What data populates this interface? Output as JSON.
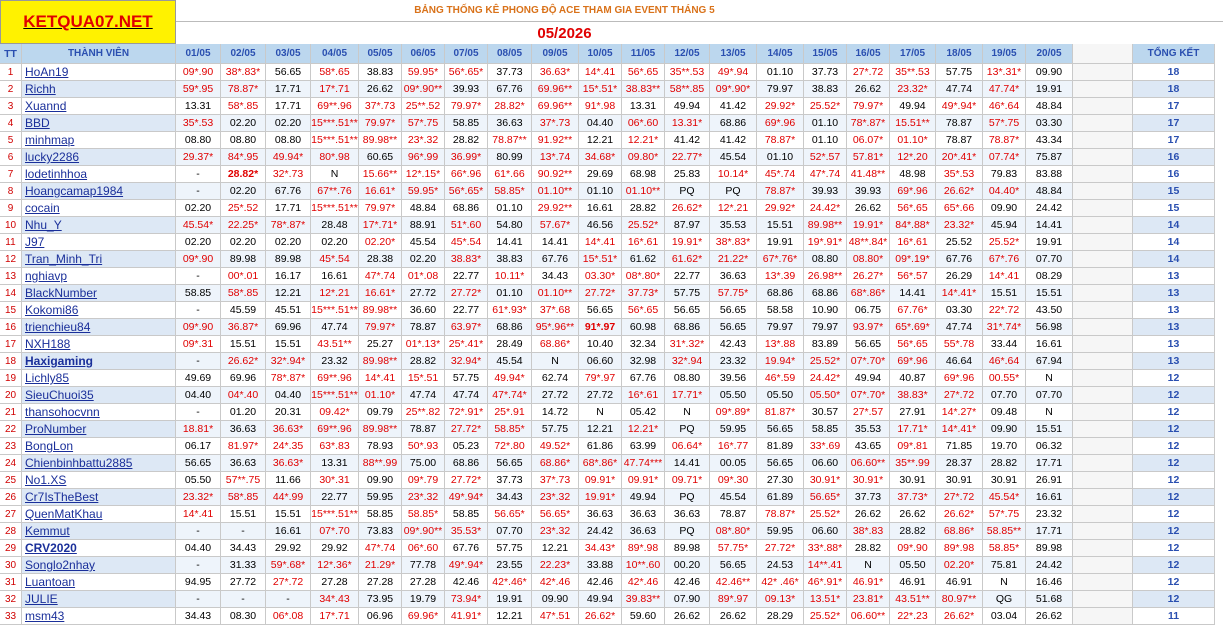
{
  "site": "KETQUA07.NET",
  "title": "BẢNG THỐNG KÊ PHONG ĐỘ ACE THAM GIA EVENT THÁNG 5",
  "month": "05/2026",
  "headers": {
    "tt": "TT",
    "member": "THÀNH VIÊN",
    "dates": [
      "01/05",
      "02/05",
      "03/05",
      "04/05",
      "05/05",
      "06/05",
      "07/05",
      "08/05",
      "09/05",
      "10/05",
      "11/05",
      "12/05",
      "13/05",
      "14/05",
      "15/05",
      "16/05",
      "17/05",
      "18/05",
      "19/05",
      "20/05"
    ],
    "total": "TỔNG KẾT"
  },
  "rows": [
    {
      "tt": "1",
      "name": "HoAn19",
      "bold": false,
      "vals": [
        "09*.90",
        "38*.83*",
        "56.65",
        "58*.65",
        "38.83",
        "59.95*",
        "56*.65*",
        "37.73",
        "36.63*",
        "14*.41",
        "56*.65",
        "35**.53",
        "49*.94",
        "01.10",
        "37.73",
        "27*.72",
        "35**.53",
        "57.75",
        "13*.31*",
        "09.90"
      ],
      "total": "18"
    },
    {
      "tt": "2",
      "name": "Richh",
      "bold": false,
      "vals": [
        "59*.95",
        "78.87*",
        "17.71",
        "17*.71",
        "26.62",
        "09*.90**",
        "39.93",
        "67.76",
        "69.96**",
        "15*.51*",
        "38.83**",
        "58**.85",
        "09*.90*",
        "79.97",
        "38.83",
        "26.62",
        "23.32*",
        "47.74",
        "47.74*",
        "19.91"
      ],
      "total": "18"
    },
    {
      "tt": "3",
      "name": "Xuannd",
      "bold": false,
      "vals": [
        "13.31",
        "58*.85",
        "17.71",
        "69**.96",
        "37*.73",
        "25**.52",
        "79.97*",
        "28.82*",
        "69.96**",
        "91*.98",
        "13.31",
        "49.94",
        "41.42",
        "29.92*",
        "25.52*",
        "79.97*",
        "49.94",
        "49*.94*",
        "46*.64",
        "48.84"
      ],
      "total": "17"
    },
    {
      "tt": "4",
      "name": "BBD",
      "bold": false,
      "vals": [
        "35*.53",
        "02.20",
        "02.20",
        "15***.51**",
        "79.97*",
        "57*.75",
        "58.85",
        "36.63",
        "37*.73",
        "04.40",
        "06*.60",
        "13.31*",
        "68.86",
        "69*.96",
        "01.10",
        "78*.87*",
        "15.51**",
        "78.87",
        "57*.75",
        "03.30"
      ],
      "total": "17"
    },
    {
      "tt": "5",
      "name": "minhmap",
      "bold": false,
      "vals": [
        "08.80",
        "08.80",
        "08.80",
        "15***.51**",
        "89.98**",
        "23*.32",
        "28.82",
        "78.87**",
        "91.92**",
        "12.21",
        "12.21*",
        "41.42",
        "41.42",
        "78.87*",
        "01.10",
        "06.07*",
        "01.10*",
        "78.87",
        "78.87*",
        "43.34"
      ],
      "total": "17"
    },
    {
      "tt": "6",
      "name": "lucky2286",
      "bold": false,
      "vals": [
        "29.37*",
        "84*.95",
        "49.94*",
        "80*.98",
        "60.65",
        "96*.99",
        "36.99*",
        "80.99",
        "13*.74",
        "34.68*",
        "09.80*",
        "22.77*",
        "45.54",
        "01.10",
        "52*.57",
        "57.81*",
        "12*.20",
        "20*.41*",
        "07.74*",
        "75.87"
      ],
      "total": "16"
    },
    {
      "tt": "7",
      "name": "lodetinhhoa",
      "bold": false,
      "vals": [
        "-",
        "28.82*",
        "32*.73",
        "N",
        "15.66**",
        "12*.15*",
        "66*.96",
        "61*.66",
        "90.92**",
        "29.69",
        "68.98",
        "25.83",
        "10.14*",
        "45*.74",
        "47*.74",
        "41.48**",
        "48.98",
        "35*.53",
        "79.83",
        "83.88"
      ],
      "total": "16"
    },
    {
      "tt": "8",
      "name": "Hoangcamap1984",
      "bold": false,
      "vals": [
        "-",
        "02.20",
        "67.76",
        "67**.76",
        "16.61*",
        "59.95*",
        "56*.65*",
        "58.85*",
        "01.10**",
        "01.10",
        "01.10**",
        "PQ",
        "PQ",
        "78.87*",
        "39.93",
        "39.93",
        "69*.96",
        "26.62*",
        "04.40*",
        "48.84"
      ],
      "total": "15"
    },
    {
      "tt": "9",
      "name": "cocain",
      "bold": false,
      "vals": [
        "02.20",
        "25*.52",
        "17.71",
        "15***.51**",
        "79.97*",
        "48.84",
        "68.86",
        "01.10",
        "29.92**",
        "16.61",
        "28.82",
        "26.62*",
        "12*.21",
        "29.92*",
        "24.42*",
        "26.62",
        "56*.65",
        "65*.66",
        "09.90",
        "24.42"
      ],
      "total": "15"
    },
    {
      "tt": "10",
      "name": "Nhu_Y",
      "bold": false,
      "vals": [
        "45.54*",
        "22.25*",
        "78*.87*",
        "28.48",
        "17*.71*",
        "88.91",
        "51*.60",
        "54.80",
        "57.67*",
        "46.56",
        "25.52*",
        "87.97",
        "35.53",
        "15.51",
        "89.98**",
        "19.91*",
        "84*.88*",
        "23.32*",
        "45.94",
        "14.41"
      ],
      "total": "14"
    },
    {
      "tt": "11",
      "name": "J97",
      "bold": false,
      "vals": [
        "02.20",
        "02.20",
        "02.20",
        "02.20",
        "02.20*",
        "45.54",
        "45*.54",
        "14.41",
        "14.41",
        "14*.41",
        "16*.61",
        "19.91*",
        "38*.83*",
        "19.91",
        "19*.91*",
        "48**.84*",
        "16*.61",
        "25.52",
        "25.52*",
        "19.91"
      ],
      "total": "14"
    },
    {
      "tt": "12",
      "name": "Tran_Minh_Tri",
      "bold": false,
      "vals": [
        "09*.90",
        "89.98",
        "89.98",
        "45*.54",
        "28.38",
        "02.20",
        "38.83*",
        "38.83",
        "67.76",
        "15*.51*",
        "61.62",
        "61.62*",
        "21.22*",
        "67*.76*",
        "08.80",
        "08.80*",
        "09*.19*",
        "67.76",
        "67*.76",
        "07.70"
      ],
      "total": "14"
    },
    {
      "tt": "13",
      "name": "nghiavp",
      "bold": false,
      "vals": [
        "-",
        "00*.01",
        "16.17",
        "16.61",
        "47*.74",
        "01*.08",
        "22.77",
        "10.11*",
        "34.43",
        "03.30*",
        "08*.80*",
        "22.77",
        "36.63",
        "13*.39",
        "26.98**",
        "26.27*",
        "56*.57",
        "26.29",
        "14*.41",
        "08.29"
      ],
      "total": "13"
    },
    {
      "tt": "14",
      "name": "BlackNumber",
      "bold": false,
      "vals": [
        "58.85",
        "58*.85",
        "12.21",
        "12*.21",
        "16.61*",
        "27.72",
        "27.72*",
        "01.10",
        "01.10**",
        "27.72*",
        "37.73*",
        "57.75",
        "57.75*",
        "68.86",
        "68.86",
        "68*.86*",
        "14.41",
        "14*.41*",
        "15.51",
        "15.51"
      ],
      "total": "13"
    },
    {
      "tt": "15",
      "name": "Kokomi86",
      "bold": false,
      "vals": [
        "-",
        "45.59",
        "45.51",
        "15***.51**",
        "89.98**",
        "36.60",
        "22.77",
        "61*.93*",
        "37*.68",
        "56.65",
        "56*.65",
        "56.65",
        "56.65",
        "58.58",
        "10.90",
        "06.75",
        "67.76*",
        "03.30",
        "22*.72",
        "43.50"
      ],
      "total": "13"
    },
    {
      "tt": "16",
      "name": "trienchieu84",
      "bold": false,
      "vals": [
        "09*.90",
        "36.87*",
        "69.96",
        "47.74",
        "79.97*",
        "78.87",
        "63.97*",
        "68.86",
        "95*.96**",
        "91*.97",
        "60.98",
        "68.86",
        "56.65",
        "79.97",
        "79.97",
        "93.97*",
        "65*.69*",
        "47.74",
        "31*.74*",
        "56.98"
      ],
      "total": "13"
    },
    {
      "tt": "17",
      "name": "NXH188",
      "bold": false,
      "vals": [
        "09*.31",
        "15.51",
        "15.51",
        "43.51**",
        "25.27",
        "01*.13*",
        "25*.41*",
        "28.49",
        "68.86*",
        "10.40",
        "32.34",
        "31*.32*",
        "42.43",
        "13*.88",
        "83.89",
        "56.65",
        "56*.65",
        "55*.78",
        "33.44",
        "16.61"
      ],
      "total": "13"
    },
    {
      "tt": "18",
      "name": "Haxigaming",
      "bold": true,
      "vals": [
        "-",
        "26.62*",
        "32*.94*",
        "23.32",
        "89.98**",
        "28.82",
        "32.94*",
        "45.54",
        "N",
        "06.60",
        "32.98",
        "32*.94",
        "23.32",
        "19.94*",
        "25.52*",
        "07*.70*",
        "69*.96",
        "46.64",
        "46*.64",
        "67.94"
      ],
      "total": "13"
    },
    {
      "tt": "19",
      "name": "Lichly85",
      "bold": false,
      "vals": [
        "49.69",
        "69.96",
        "78*.87*",
        "69**.96",
        "14*.41",
        "15*.51",
        "57.75",
        "49.94*",
        "62.74",
        "79*.97",
        "67.76",
        "08.80",
        "39.56",
        "46*.59",
        "24.42*",
        "49.94",
        "40.87",
        "69*.96",
        "00.55*",
        "N"
      ],
      "total": "12"
    },
    {
      "tt": "20",
      "name": "SieuChuoi35",
      "bold": false,
      "vals": [
        "04.40",
        "04*.40",
        "04.40",
        "15***.51**",
        "01.10*",
        "47.74",
        "47.74",
        "47*.74*",
        "27.72",
        "27.72",
        "16*.61",
        "17.71*",
        "05.50",
        "05.50",
        "05.50*",
        "07*.70*",
        "38.83*",
        "27*.72",
        "07.70",
        "07.70"
      ],
      "total": "12"
    },
    {
      "tt": "21",
      "name": "thansohocvnn",
      "bold": false,
      "vals": [
        "-",
        "01.20",
        "20.31",
        "09.42*",
        "09.79",
        "25**.82",
        "72*.91*",
        "25*.91",
        "14.72",
        "N",
        "05.42",
        "N",
        "09*.89*",
        "81.87*",
        "30.57",
        "27*.57",
        "27.91",
        "14*.27*",
        "09.48",
        "N"
      ],
      "total": "12"
    },
    {
      "tt": "22",
      "name": "ProNumber",
      "bold": false,
      "vals": [
        "18.81*",
        "36.63",
        "36.63*",
        "69**.96",
        "89.98**",
        "78.87",
        "27.72*",
        "58.85*",
        "57.75",
        "12.21",
        "12.21*",
        "PQ",
        "59.95",
        "56.65",
        "58.85",
        "35.53",
        "17.71*",
        "14*.41*",
        "09.90",
        "15.51"
      ],
      "total": "12"
    },
    {
      "tt": "23",
      "name": "BongLon",
      "bold": false,
      "vals": [
        "06.17",
        "81.97*",
        "24*.35",
        "63*.83",
        "78.93",
        "50*.93",
        "05.23",
        "72*.80",
        "49.52*",
        "61.86",
        "63.99",
        "06.64*",
        "16*.77",
        "81.89",
        "33*.69",
        "43.65",
        "09*.81",
        "71.85",
        "19.70",
        "06.32"
      ],
      "total": "12"
    },
    {
      "tt": "24",
      "name": "Chienbinhbattu2885",
      "bold": false,
      "vals": [
        "56.65",
        "36.63",
        "36.63*",
        "13.31",
        "88**.99",
        "75.00",
        "68.86",
        "56.65",
        "68.86*",
        "68*.86*",
        "47.74***",
        "14.41",
        "00.05",
        "56.65",
        "06.60",
        "06.60**",
        "35**.99",
        "28.37",
        "28.82",
        "17.71"
      ],
      "total": "12"
    },
    {
      "tt": "25",
      "name": "No1.XS",
      "bold": false,
      "vals": [
        "05.50",
        "57**.75",
        "11.66",
        "30*.31",
        "09.90",
        "09*.79",
        "27.72*",
        "37.73",
        "37*.73",
        "09.91*",
        "09.91*",
        "09.71*",
        "09*.30",
        "27.30",
        "30.91*",
        "30.91*",
        "30.91",
        "30.91",
        "30.91",
        "26.91"
      ],
      "total": "12"
    },
    {
      "tt": "26",
      "name": "Cr7IsTheBest",
      "bold": false,
      "vals": [
        "23.32*",
        "58*.85",
        "44*.99",
        "22.77",
        "59.95",
        "23*.32",
        "49*.94*",
        "34.43",
        "23*.32",
        "19.91*",
        "49.94",
        "PQ",
        "45.54",
        "61.89",
        "56.65*",
        "37.73",
        "37.73*",
        "27*.72",
        "45.54*",
        "16.61"
      ],
      "total": "12"
    },
    {
      "tt": "27",
      "name": "QuenMatKhau",
      "bold": false,
      "vals": [
        "14*.41",
        "15.51",
        "15.51",
        "15***.51**",
        "58.85",
        "58.85*",
        "58.85",
        "56.65*",
        "56.65*",
        "36.63",
        "36.63",
        "36.63",
        "78.87",
        "78.87*",
        "25.52*",
        "26.62",
        "26.62",
        "26.62*",
        "57*.75",
        "23.32"
      ],
      "total": "12"
    },
    {
      "tt": "28",
      "name": "Kemmut",
      "bold": false,
      "vals": [
        "-",
        "-",
        "16.61",
        "07*.70",
        "73.83",
        "09*.90**",
        "35.53*",
        "07.70",
        "23*.32",
        "24.42",
        "36.63",
        "PQ",
        "08*.80*",
        "59.95",
        "06.60",
        "38*.83",
        "28.82",
        "68.86*",
        "58.85**",
        "17.71"
      ],
      "total": "12"
    },
    {
      "tt": "29",
      "name": "CRV2020",
      "bold": true,
      "vals": [
        "04.40",
        "34.43",
        "29.92",
        "29.92",
        "47*.74",
        "06*.60",
        "67.76",
        "57.75",
        "12.21",
        "34.43*",
        "89*.98",
        "89.98",
        "57.75*",
        "27.72*",
        "33*.88*",
        "28.82",
        "09*.90",
        "89*.98",
        "58.85*",
        "89.98"
      ],
      "total": "12"
    },
    {
      "tt": "30",
      "name": "Songlo2nhay",
      "bold": false,
      "vals": [
        "-",
        "31.33",
        "59*.68*",
        "12*.36*",
        "21.29*",
        "77.78",
        "49*.94*",
        "23.55",
        "22.23*",
        "33.88",
        "10**.60",
        "00.20",
        "56.65",
        "24.53",
        "14**.41",
        "N",
        "05.50",
        "02.20*",
        "75.81",
        "24.42"
      ],
      "total": "12"
    },
    {
      "tt": "31",
      "name": "Luantoan",
      "bold": false,
      "vals": [
        "94.95",
        "27.72",
        "27*.72",
        "27.28",
        "27.28",
        "27.28",
        "42.46",
        "42*.46*",
        "42*.46",
        "42.46",
        "42*.46",
        "42.46",
        "42.46**",
        "42* .46*",
        "46*.91*",
        "46.91*",
        "46.91",
        "46.91",
        "N",
        "16.46"
      ],
      "total": "12"
    },
    {
      "tt": "32",
      "name": "JULIE",
      "bold": false,
      "vals": [
        "-",
        "-",
        "-",
        "34*.43",
        "73.95",
        "19.79",
        "73.94*",
        "19.91",
        "09.90",
        "49.94",
        "39.83**",
        "07.90",
        "89*.97",
        "09.13*",
        "13.51*",
        "23.81*",
        "43.51**",
        "80.97**",
        "QG",
        "51.68"
      ],
      "total": "12"
    },
    {
      "tt": "33",
      "name": "msm43",
      "bold": false,
      "vals": [
        "34.43",
        "08.30",
        "06*.08",
        "17*.71",
        "06.96",
        "69.96*",
        "41.91*",
        "12.21",
        "47*.51",
        "26.62*",
        "59.60",
        "26.62",
        "26.62",
        "28.29",
        "25.52*",
        "06.60**",
        "22*.23",
        "26.62*",
        "03.04",
        "26.62"
      ],
      "total": "11"
    }
  ]
}
